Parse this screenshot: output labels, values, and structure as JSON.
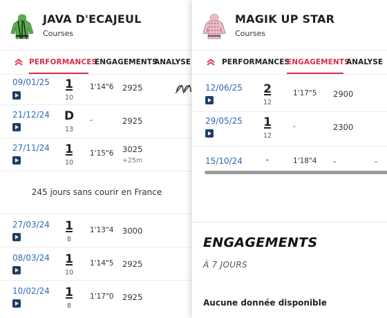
{
  "left": {
    "horse_name": "JAVA D'ECAJEUL",
    "subtitle": "Courses",
    "silk_colors": {
      "main": "#5aaa4d",
      "stripe": "#1c1c1c",
      "cap": "#5aaa4d"
    },
    "tabs": [
      {
        "label": "PERFORMANCES",
        "active": true
      },
      {
        "label": "ENGAGEMENTS",
        "active": false
      },
      {
        "label": "ANALYSE",
        "active": false
      }
    ],
    "races": [
      {
        "date": "09/01/25",
        "place": "1",
        "runners": "10",
        "time": "1'14\"6",
        "distance": "2925",
        "extra": "",
        "shoe_icon": "shoe-removed-icon"
      },
      {
        "date": "21/12/24",
        "place": "D",
        "runners": "13",
        "time": "-",
        "distance": "2925",
        "extra": ""
      },
      {
        "date": "27/11/24",
        "place": "1",
        "runners": "10",
        "time": "1'15\"6",
        "distance": "3025",
        "extra": "+25m"
      },
      {
        "date": "27/03/24",
        "place": "1",
        "runners": "8",
        "time": "1'13\"4",
        "distance": "3000",
        "extra": ""
      },
      {
        "date": "08/03/24",
        "place": "1",
        "runners": "10",
        "time": "1'14\"5",
        "distance": "2925",
        "extra": ""
      },
      {
        "date": "10/02/24",
        "place": "1",
        "runners": "8",
        "time": "1'17\"0",
        "distance": "2925",
        "extra": ""
      }
    ],
    "gap_note": "245 jours sans courir en France"
  },
  "right": {
    "horse_name": "MAGIK UP STAR",
    "subtitle": "Courses",
    "silk_colors": {
      "main": "#f2b8c8",
      "stripe": "#555555",
      "cap": "#f2b8c8"
    },
    "tabs": [
      {
        "label": "PERFORMANCES",
        "active": false
      },
      {
        "label": "ENGAGEMENTS",
        "active": true
      },
      {
        "label": "ANALYSE",
        "active": false
      }
    ],
    "races": [
      {
        "date": "12/06/25",
        "place": "2",
        "runners": "12",
        "time": "1'17\"5",
        "distance": "2900"
      },
      {
        "date": "29/05/25",
        "place": "1",
        "runners": "12",
        "time": "-",
        "distance": "2300"
      },
      {
        "date": "15/10/24",
        "place": "-",
        "runners": "",
        "time": "1'18\"4",
        "distance": "-",
        "tail": "-"
      }
    ],
    "engagements_title": "ENGAGEMENTS",
    "engagements_sub": "À 7 JOURS",
    "engagements_empty": "Aucune donnée disponible"
  },
  "accent_color": "#d6304b",
  "link_color": "#2f68b5"
}
